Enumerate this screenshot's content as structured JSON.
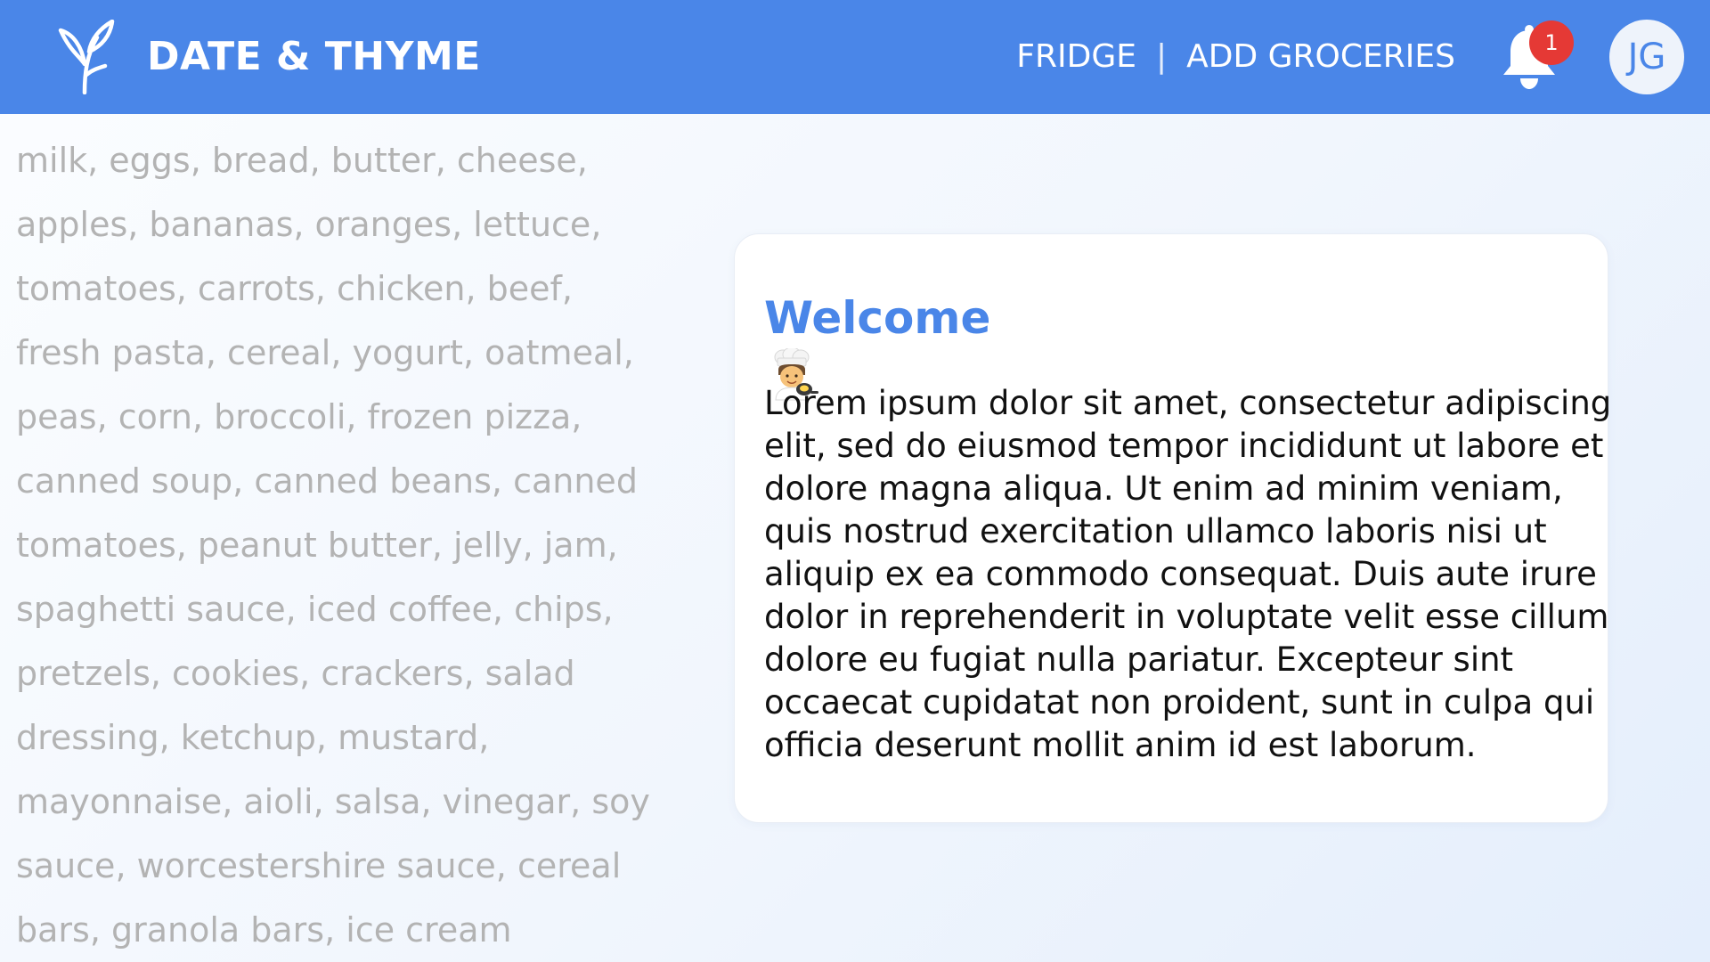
{
  "header": {
    "brand": "DATE & THYME",
    "nav": {
      "fridge": "FRIDGE",
      "separator": "|",
      "add_groceries": "ADD GROCERIES"
    },
    "notifications": {
      "icon": "bell-icon",
      "count": "1"
    },
    "avatar_initials": "JG",
    "logo_icon": "sprout-icon"
  },
  "groceries": {
    "lines": [
      "milk, eggs, bread, butter, cheese,",
      "apples, bananas, oranges, lettuce,",
      "tomatoes, carrots, chicken, beef,",
      "fresh pasta, cereal, yogurt, oatmeal,",
      "peas, corn, broccoli, frozen pizza,",
      "canned soup, canned beans, canned",
      "tomatoes, peanut butter, jelly, jam,",
      "spaghetti sauce, iced coffee, chips,",
      "pretzels, cookies, crackers, salad",
      "dressing, ketchup, mustard,",
      "mayonnaise, aioli, salsa, vinegar, soy",
      "sauce, worcestershire sauce, cereal",
      "bars, granola bars, ice cream"
    ]
  },
  "welcome": {
    "title": "Welcome",
    "icon": "chef-icon",
    "body_lines": [
      "Lorem ipsum dolor sit amet, consectetur adipiscing",
      "elit, sed do eiusmod tempor incididunt ut labore et",
      "dolore magna aliqua. Ut enim ad minim veniam,",
      "quis nostrud exercitation ullamco laboris nisi ut",
      "aliquip ex ea commodo consequat. Duis aute irure",
      "dolor in reprehenderit in voluptate velit esse cillum",
      "dolore eu fugiat nulla pariatur. Excepteur sint",
      "occaecat cupidatat non proident, sunt in culpa qui",
      "officia deserunt mollit anim id est laborum."
    ]
  },
  "colors": {
    "header": "#4a86e8",
    "accent": "#4a86e8",
    "badge": "#e53935",
    "muted_text": "#b3b3b3"
  }
}
